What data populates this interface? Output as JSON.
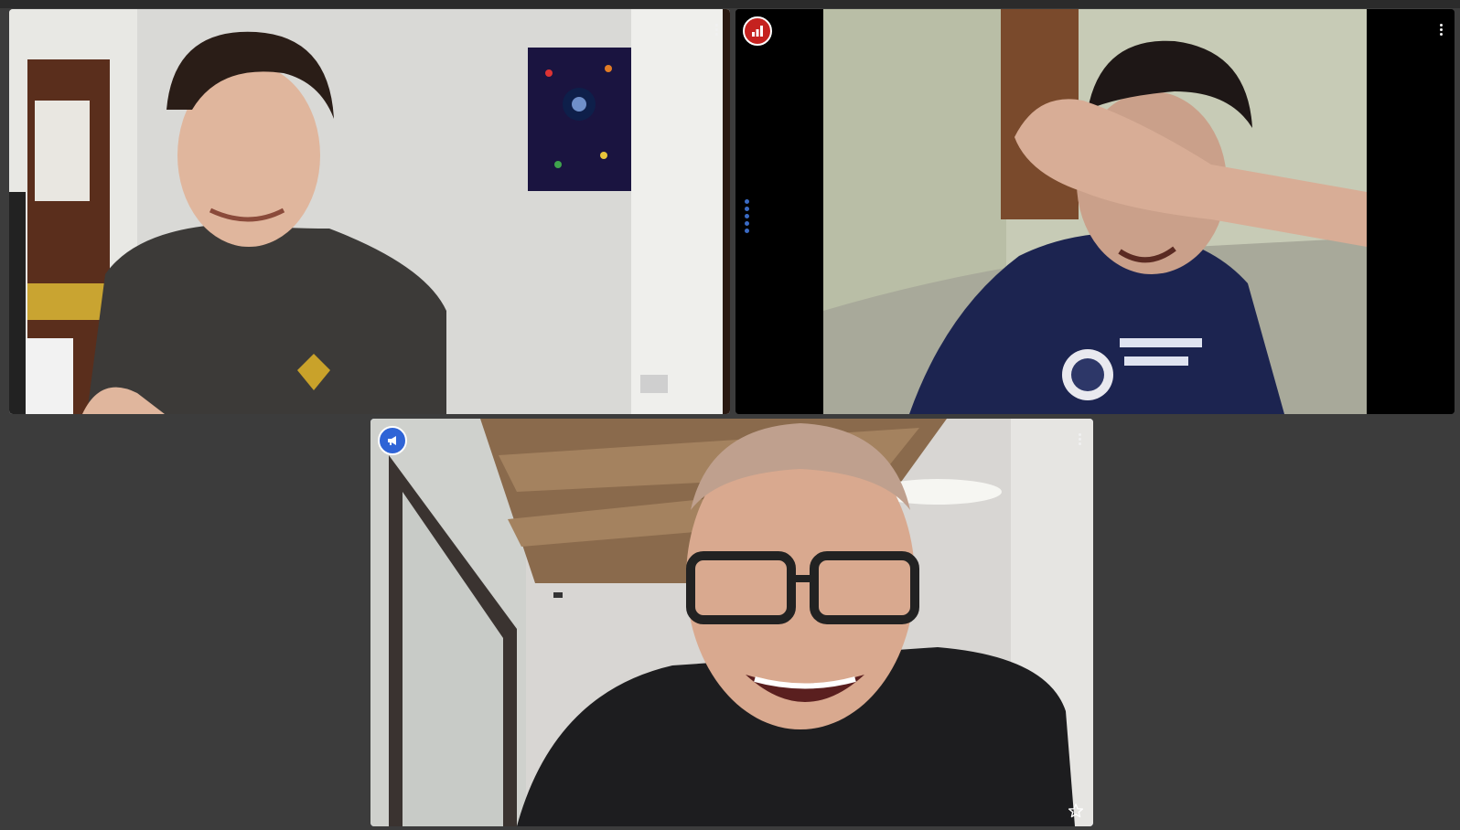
{
  "app": {
    "type": "video-call-grid",
    "colors": {
      "background": "#3c3c3c",
      "active_speaker_border": "#3f6fd8",
      "audio_badge": "#c5221f",
      "presenter_badge": "#2f64d6"
    }
  },
  "participants": [
    {
      "id": "p1",
      "tile_menu_icon": "more-vert-icon",
      "speaking": false
    },
    {
      "id": "p2",
      "status_icon": "audio-level-icon",
      "status_color": "#c5221f",
      "tile_menu_icon": "more-vert-icon",
      "speaking": false
    },
    {
      "id": "p3",
      "status_icon": "megaphone-icon",
      "status_color": "#2f64d6",
      "tile_menu_icon": "more-vert-icon",
      "pin_icon": "star-outline-icon",
      "speaking": true
    }
  ]
}
